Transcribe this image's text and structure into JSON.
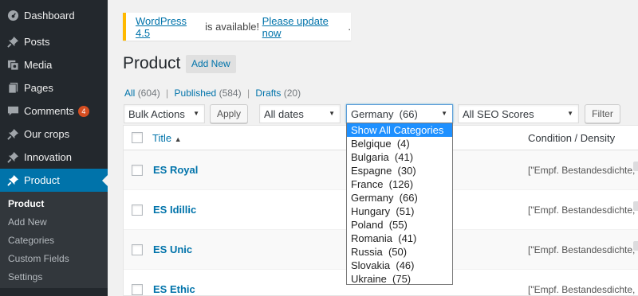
{
  "sidebar": {
    "items": [
      {
        "label": "Dashboard",
        "icon": "dashboard-icon"
      },
      {
        "label": "Posts",
        "icon": "pin-icon"
      },
      {
        "label": "Media",
        "icon": "media-icon"
      },
      {
        "label": "Pages",
        "icon": "pages-icon"
      },
      {
        "label": "Comments",
        "icon": "comment-icon",
        "badge": "4"
      },
      {
        "label": "Our crops",
        "icon": "pin-icon"
      },
      {
        "label": "Innovation",
        "icon": "pin-icon"
      },
      {
        "label": "Product",
        "icon": "pin-icon"
      }
    ],
    "submenu": [
      "Product",
      "Add New",
      "Categories",
      "Custom Fields",
      "Settings"
    ]
  },
  "notice": {
    "link1": "WordPress 4.5",
    "middle": " is available! ",
    "link2": "Please update now",
    "end": "."
  },
  "page": {
    "title": "Product",
    "add_new": "Add New"
  },
  "views": {
    "all": "All",
    "all_count": "(604)",
    "published": "Published",
    "published_count": "(584)",
    "drafts": "Drafts",
    "drafts_count": "(20)",
    "separator": "|"
  },
  "filters": {
    "bulk_actions": "Bulk Actions",
    "apply": "Apply",
    "dates": "All dates",
    "category": "Germany  (66)",
    "seo": "All SEO Scores",
    "filter": "Filter"
  },
  "dropdown": {
    "options": [
      "Show All Categories",
      "Belgique  (4)",
      "Bulgaria  (41)",
      "Espagne  (30)",
      "France  (126)",
      "Germany  (66)",
      "Hungary  (51)",
      "Poland  (55)",
      "Romania  (41)",
      "Russia  (50)",
      "Slovakia  (46)",
      "Ukraine  (75)"
    ],
    "highlighted_index": 0
  },
  "table": {
    "col_title": "Title",
    "sort_indicator": "▲",
    "col_condition": "Condition / Density",
    "rows": [
      {
        "title": "ES Royal",
        "condition": "[\"Empf. Bestandesdichte, KV"
      },
      {
        "title": "ES Idillic",
        "condition": "[\"Empf. Bestandesdichte, KV"
      },
      {
        "title": "ES Unic",
        "condition": "[\"Empf. Bestandesdichte, KV"
      },
      {
        "title": "ES Ethic",
        "condition": "[\"Empf. Bestandesdichte, KV"
      }
    ]
  },
  "colors": {
    "sidebar_bg": "#23282d",
    "active_bg": "#0073aa",
    "link": "#0073aa",
    "notice_border": "#ffb900",
    "badge": "#d54e21",
    "dropdown_highlight": "#1e90ff"
  }
}
